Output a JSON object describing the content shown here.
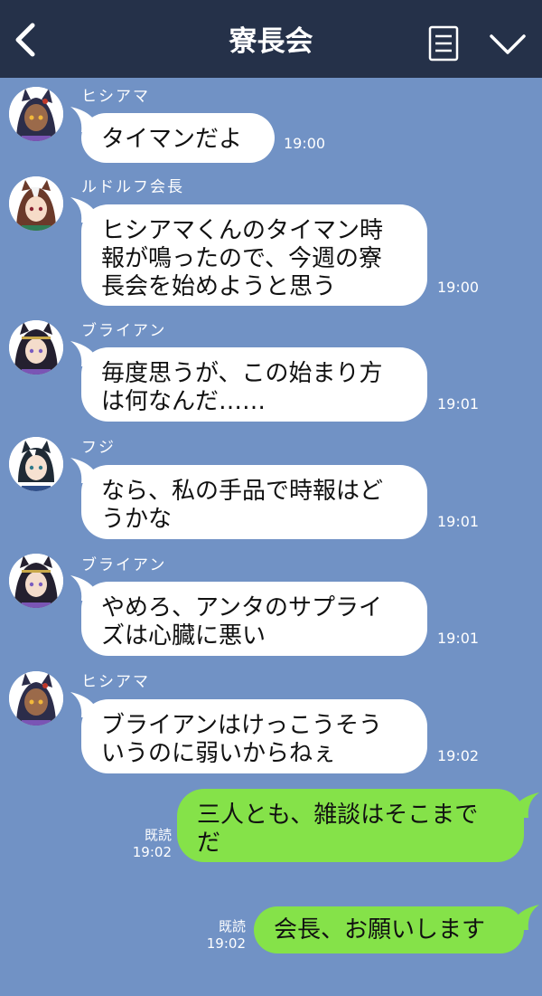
{
  "header": {
    "title": "寮長会",
    "back_icon": "chevron-left-icon",
    "menu_icon": "document-list-icon",
    "more_icon": "chevron-down-icon"
  },
  "colors": {
    "header_bg": "#253149",
    "chat_bg": "#7192c5",
    "incoming_bubble": "#ffffff",
    "outgoing_bubble": "#85e249"
  },
  "messages": [
    {
      "sender": "ヒシアマ",
      "text": "タイマンだよ",
      "time": "19:00"
    },
    {
      "sender": "ルドルフ会長",
      "text": "ヒシアマくんのタイマン時\n報が鳴ったので、今週の寮\n長会を始めようと思う",
      "time": "19:00"
    },
    {
      "sender": "ブライアン",
      "text": "毎度思うが、この始まり方\nは何なんだ……",
      "time": "19:01"
    },
    {
      "sender": "フジ",
      "text": "なら、私の手品で時報はど\nうかな",
      "time": "19:01"
    },
    {
      "sender": "ブライアン",
      "text": "やめろ、アンタのサプライ\nズは心臓に悪い",
      "time": "19:01"
    },
    {
      "sender": "ヒシアマ",
      "text": "ブライアンはけっこうそう\nいうのに弱いからねぇ",
      "time": "19:02"
    }
  ],
  "outgoing": [
    {
      "text": "三人とも、雑談はそこまで\nだ",
      "read_label": "既読",
      "time": "19:02"
    },
    {
      "text": "会長、お願いします",
      "read_label": "既読",
      "time": "19:02"
    }
  ]
}
